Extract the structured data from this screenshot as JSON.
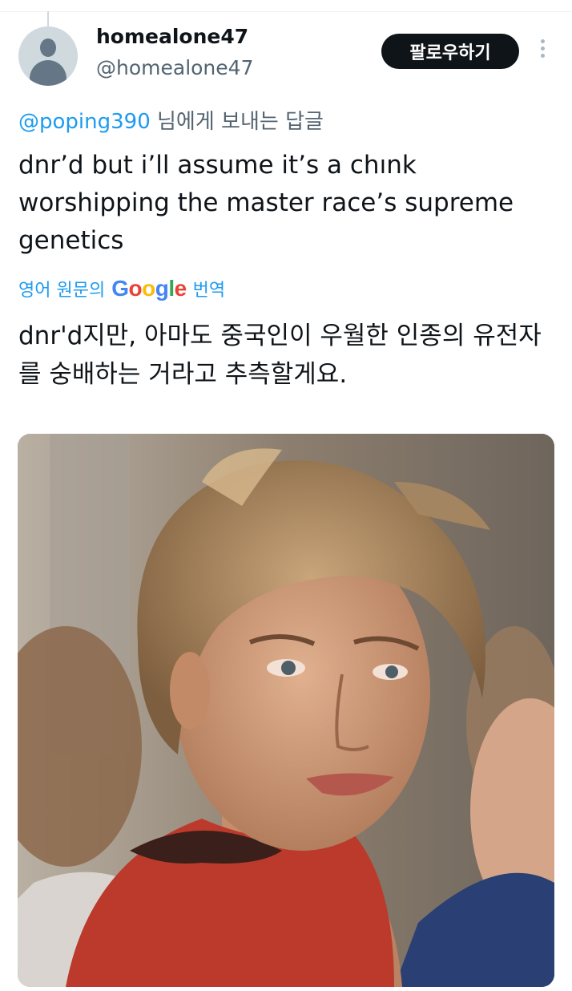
{
  "author": {
    "display_name": "homealone47",
    "handle": "@homealone47",
    "avatar_icon": "default-avatar-icon"
  },
  "actions": {
    "follow_label": "팔로우하기",
    "more_icon": "more-vertical-icon"
  },
  "reply": {
    "mention": "@poping390",
    "suffix": " 님에게 보내는 답글"
  },
  "tweet": {
    "text": "dnr’d but i’ll assume it’s a chınk worshipping the master race’s supreme genetics"
  },
  "translation": {
    "prefix": "영어 원문의",
    "google_logo": "Google",
    "suffix": "번역",
    "text": "dnr'd지만, 아마도 중국인이 우월한 인종의 유전자를 숭배하는 거라고 추측할게요."
  },
  "media": {
    "description_icon": "photo-young-man-blond-hair-red-shirt"
  },
  "colors": {
    "link": "#1d9bf0",
    "secondary_text": "#536471",
    "follow_button_bg": "#0f1419",
    "follow_button_text": "#ffffff"
  }
}
